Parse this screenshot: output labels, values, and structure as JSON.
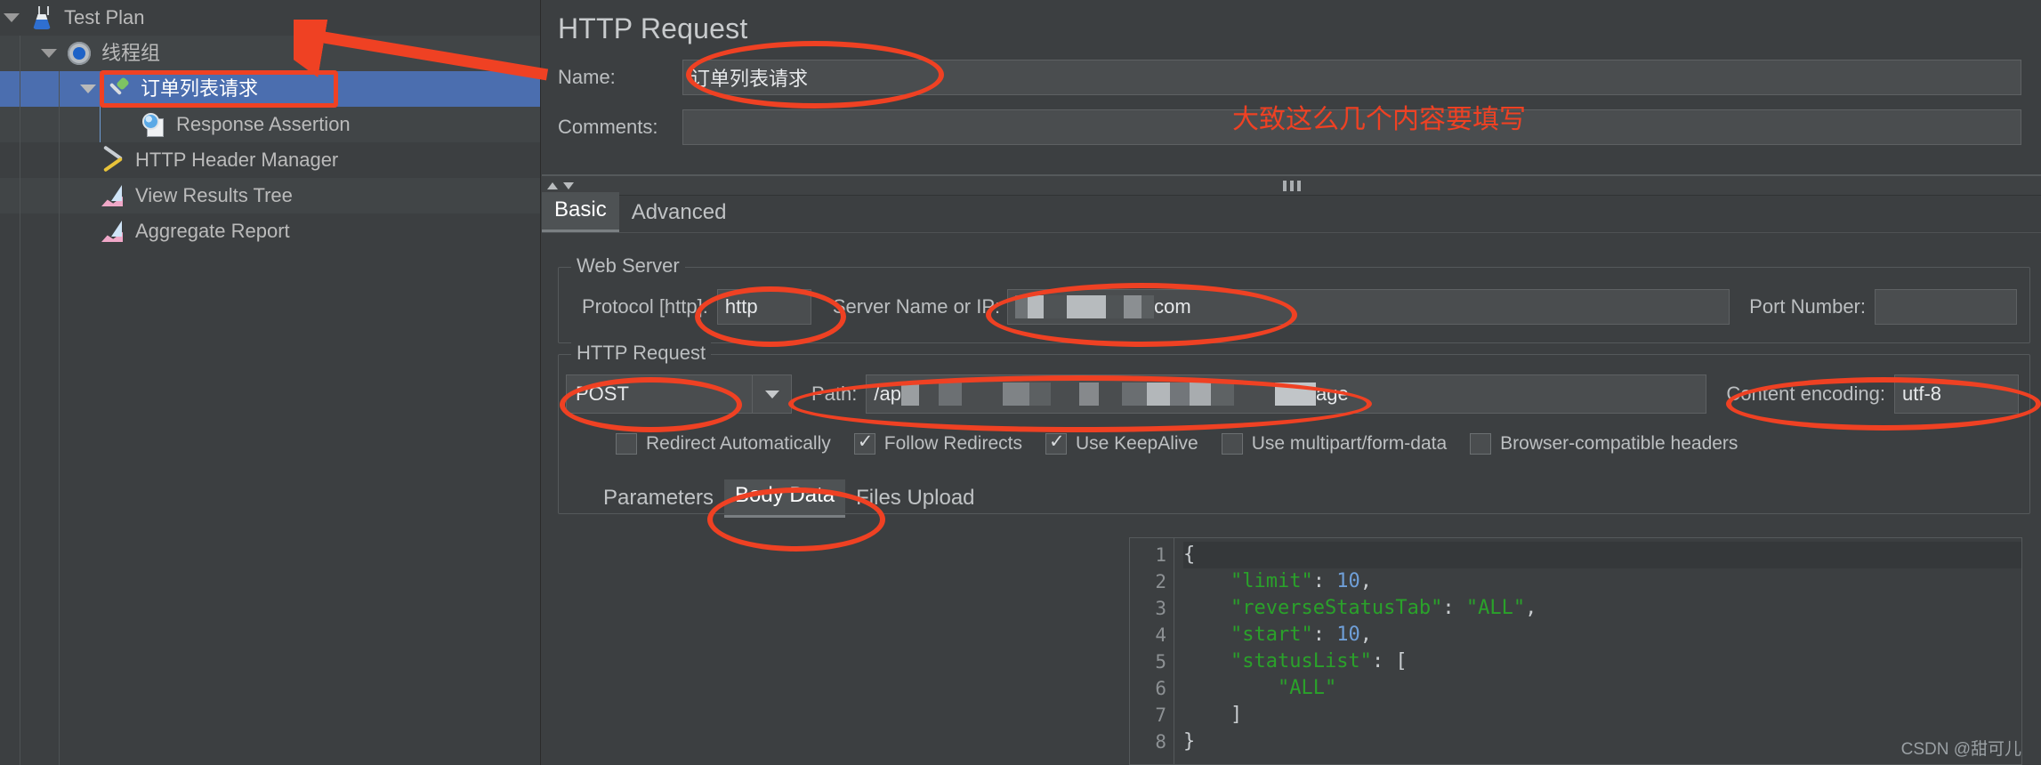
{
  "tree": {
    "items": [
      {
        "label": "Test Plan",
        "icon": "flask-icon",
        "indent": 0,
        "twisty": "expanded",
        "selected": false
      },
      {
        "label": "线程组",
        "icon": "gear-icon",
        "indent": 1,
        "twisty": "expanded",
        "selected": false
      },
      {
        "label": "订单列表请求",
        "icon": "pipette-icon",
        "indent": 2,
        "twisty": "expanded",
        "selected": true
      },
      {
        "label": "Response Assertion",
        "icon": "magnifier-page-icon",
        "indent": 3,
        "twisty": "none",
        "selected": false
      },
      {
        "label": "HTTP Header Manager",
        "icon": "tools-icon",
        "indent": 2,
        "twisty": "none",
        "selected": false
      },
      {
        "label": "View Results Tree",
        "icon": "chart-icon",
        "indent": 2,
        "twisty": "none",
        "selected": false
      },
      {
        "label": "Aggregate Report",
        "icon": "chart-icon",
        "indent": 2,
        "twisty": "none",
        "selected": false
      }
    ]
  },
  "panel": {
    "title": "HTTP Request",
    "name_label": "Name:",
    "name_value": "订单列表请求",
    "comments_label": "Comments:",
    "comments_value": ""
  },
  "tabs": {
    "basic": "Basic",
    "advanced": "Advanced"
  },
  "web_server": {
    "group_title": "Web Server",
    "protocol_label": "Protocol [http]:",
    "protocol_value": "http",
    "server_label": "Server Name or IP:",
    "server_value_suffix": "com",
    "port_label": "Port Number:",
    "port_value": ""
  },
  "http_request": {
    "group_title": "HTTP Request",
    "method_value": "POST",
    "path_label": "Path:",
    "path_prefix": "/ap",
    "path_suffix": "age",
    "encoding_label": "Content encoding:",
    "encoding_value": "utf-8",
    "checkboxes": [
      {
        "label": "Redirect Automatically",
        "checked": false
      },
      {
        "label": "Follow Redirects",
        "checked": true
      },
      {
        "label": "Use KeepAlive",
        "checked": true
      },
      {
        "label": "Use multipart/form-data",
        "checked": false
      },
      {
        "label": "Browser-compatible headers",
        "checked": false
      }
    ]
  },
  "body_tabs": {
    "parameters": "Parameters",
    "body_data": "Body Data",
    "files_upload": "Files Upload"
  },
  "editor": {
    "line_numbers": [
      "1",
      "2",
      "3",
      "4",
      "5",
      "6",
      "7",
      "8"
    ],
    "lines": [
      "{",
      "    \"limit\": 10,",
      "    \"reverseStatusTab\": \"ALL\",",
      "    \"start\": 10,",
      "    \"statusList\": [",
      "        \"ALL\"",
      "    ]",
      "}"
    ]
  },
  "annotations": {
    "note_text": "大致这么几个内容要填写",
    "color": "#ef4123"
  },
  "watermark": "CSDN @甜可儿"
}
